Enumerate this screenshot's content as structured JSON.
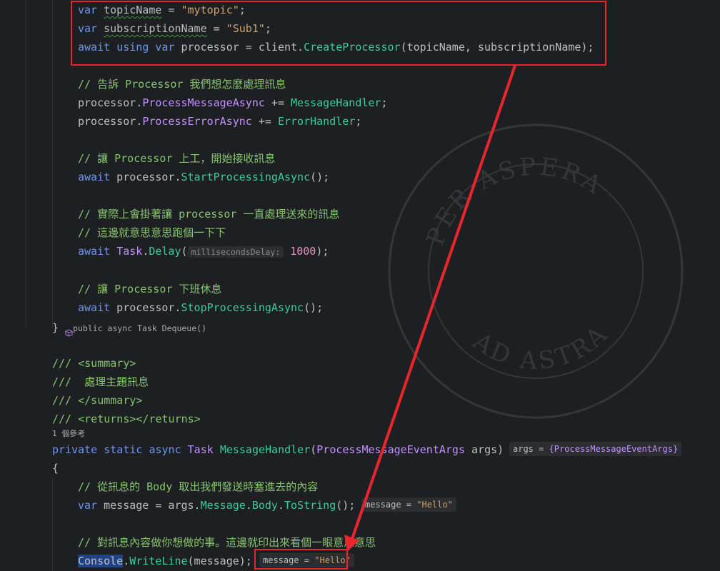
{
  "code": {
    "line1_var": "var",
    "line1_name": "topicName",
    "line1_eq": " = ",
    "line1_str": "\"mytopic\"",
    "line1_end": ";",
    "line2_var": "var",
    "line2_name": "subscriptionName",
    "line2_eq": " = ",
    "line2_str": "\"Sub1\"",
    "line2_end": ";",
    "line3_await": "await",
    "line3_using": "using",
    "line3_var": "var",
    "line3_rest1": " processor = client.",
    "line3_fn": "CreateProcessor",
    "line3_rest2": "(topicName, subscriptionName);",
    "comment1": "// 告訴 Processor 我們想怎麼處理訊息",
    "line5_a": "processor.",
    "line5_prop": "ProcessMessageAsync",
    "line5_b": " += ",
    "line5_fn": "MessageHandler",
    "line5_c": ";",
    "line6_a": "processor.",
    "line6_prop": "ProcessErrorAsync",
    "line6_b": " += ",
    "line6_fn": "ErrorHandler",
    "line6_c": ";",
    "comment2": "// 讓 Processor 上工，開始接收訊息",
    "line8_await": "await",
    "line8_a": " processor.",
    "line8_fn": "StartProcessingAsync",
    "line8_b": "();",
    "comment3": "// 實際上會掛著讓 processor 一直處理送來的訊息",
    "comment4": "// 這邊就意思意思跑個一下下",
    "line11_await": "await",
    "line11_type": "Task",
    "line11_dot": ".",
    "line11_fn": "Delay",
    "line11_paren": "(",
    "line11_hint": "millisecondsDelay:",
    "line11_num": "1000",
    "line11_end": ");",
    "comment5": "// 讓 Processor 下班休息",
    "line13_await": "await",
    "line13_a": " processor.",
    "line13_fn": "StopProcessingAsync",
    "line13_b": "();",
    "closing_brace": "}",
    "closing_hint": "public async Task Dequeue()",
    "xml1": "/// <summary>",
    "xml2": "///  處理主題訊息",
    "xml3": "/// </summary>",
    "xml4": "/// <returns></returns>",
    "usages": "1 個參考",
    "sig_private": "private",
    "sig_static": "static",
    "sig_async": "async",
    "sig_task": "Task",
    "sig_fn": "MessageHandler",
    "sig_paren": "(",
    "sig_type": "ProcessMessageEventArgs",
    "sig_args": " args)",
    "sig_inlay_name": "args = ",
    "sig_inlay_val": "{ProcessMessageEventArgs}",
    "open_brace": "{",
    "comment6": "// 從訊息的 Body 取出我們發送時塞進去的內容",
    "line_msg_var": "var",
    "line_msg_a": " message = args.",
    "line_msg_p1": "Message",
    "line_msg_dot1": ".",
    "line_msg_p2": "Body",
    "line_msg_dot2": ".",
    "line_msg_fn": "ToString",
    "line_msg_end": "();",
    "line_msg_inlay_name": "message = ",
    "line_msg_inlay_val": "\"Hello\"",
    "comment7": "// 對訊息內容做你想做的事。這邊就印出來看個一眼意思意思",
    "last_console": "Console",
    "last_dot": ".",
    "last_fn": "WriteLine",
    "last_rest": "(message);",
    "last_inlay_name": "message = ",
    "last_inlay_val": "\"Hello\""
  },
  "watermark": {
    "top_text": "PER ASPERA",
    "bottom_text": "AD ASTRA"
  },
  "colors": {
    "background": "#1e1f22",
    "annotation_red": "#e8262c",
    "keyword": "#6c95eb",
    "string": "#c9a26d",
    "method": "#39cc9b",
    "property": "#c191ff",
    "comment": "#85c46c"
  }
}
